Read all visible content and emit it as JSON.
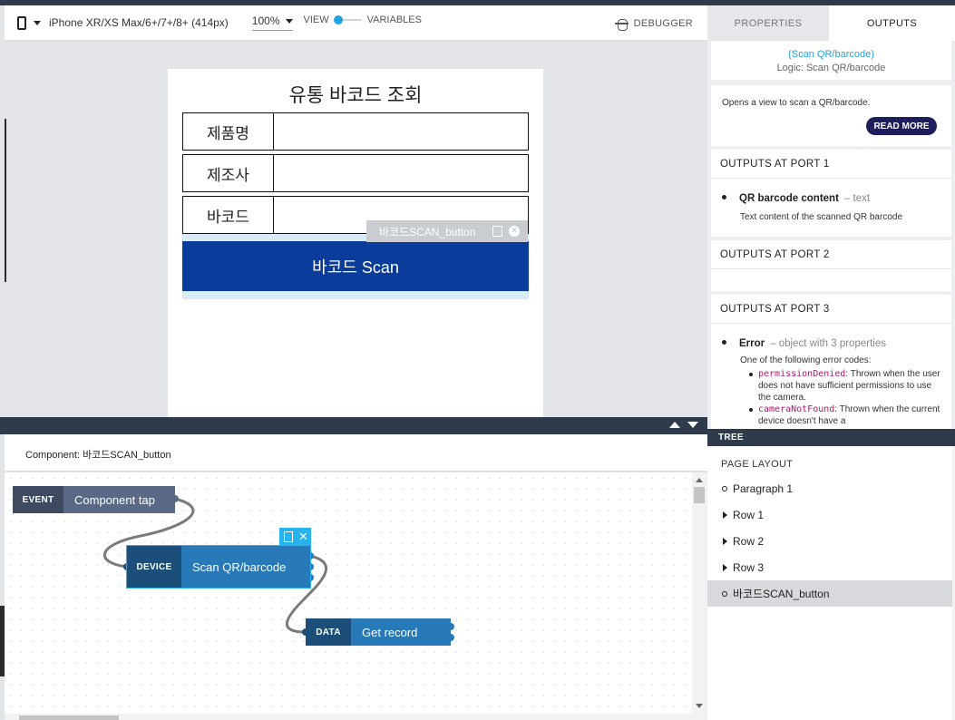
{
  "toolbar": {
    "device_label": "iPhone XR/XS Max/6+/7+/8+ (414px)",
    "zoom": "100%",
    "view_label": "VIEW",
    "variables_label": "VARIABLES",
    "debugger_label": "DEBUGGER"
  },
  "phone": {
    "title": "유통 바코드 조회",
    "rows": [
      {
        "label": "제품명"
      },
      {
        "label": "제조사"
      },
      {
        "label": "바코드"
      }
    ],
    "scan_button_label": "바코드 Scan",
    "selection_tag": "바코드SCAN_button"
  },
  "logic": {
    "component_label": "Component: 바코드SCAN_button",
    "nodes": {
      "event": {
        "tag": "EVENT",
        "name": "Component tap"
      },
      "device": {
        "tag": "DEVICE",
        "name": "Scan QR/barcode"
      },
      "data": {
        "tag": "DATA",
        "name": "Get record"
      }
    }
  },
  "right_panel": {
    "tabs": [
      "PROPERTIES",
      "OUTPUTS"
    ],
    "active_tab": "OUTPUTS",
    "logic_title": "(Scan QR/barcode)",
    "logic_subtitle": "Logic: Scan QR/barcode",
    "description": "Opens a view to scan a QR/barcode.",
    "read_more": "READ MORE",
    "ports": [
      {
        "title": "OUTPUTS AT PORT 1",
        "item_name": "QR barcode content",
        "item_type": "– text",
        "item_desc": "Text content of the scanned QR barcode"
      },
      {
        "title": "OUTPUTS AT PORT 2"
      },
      {
        "title": "OUTPUTS AT PORT 3",
        "item_name": "Error",
        "item_type": "– object with 3 properties",
        "item_desc": "One of the following error codes:",
        "codes": [
          {
            "code": "permissionDenied",
            "text": ": Thrown when the user does not have sufficient permissions to use the camera."
          },
          {
            "code": "cameraNotFound",
            "text": ": Thrown when the current device doesn't have a"
          }
        ]
      }
    ]
  },
  "tree": {
    "header": "TREE",
    "title": "PAGE LAYOUT",
    "items": [
      {
        "label": "Paragraph 1",
        "kind": "leaf"
      },
      {
        "label": "Row 1",
        "kind": "branch"
      },
      {
        "label": "Row 2",
        "kind": "branch"
      },
      {
        "label": "Row 3",
        "kind": "branch"
      },
      {
        "label": "바코드SCAN_button",
        "kind": "leaf",
        "selected": true
      }
    ]
  },
  "colors": {
    "accent": "#1ea4e0",
    "scan_button": "#0a3c9c",
    "dark_bar": "#2f3a4a",
    "read_more": "#1e1e5c"
  }
}
